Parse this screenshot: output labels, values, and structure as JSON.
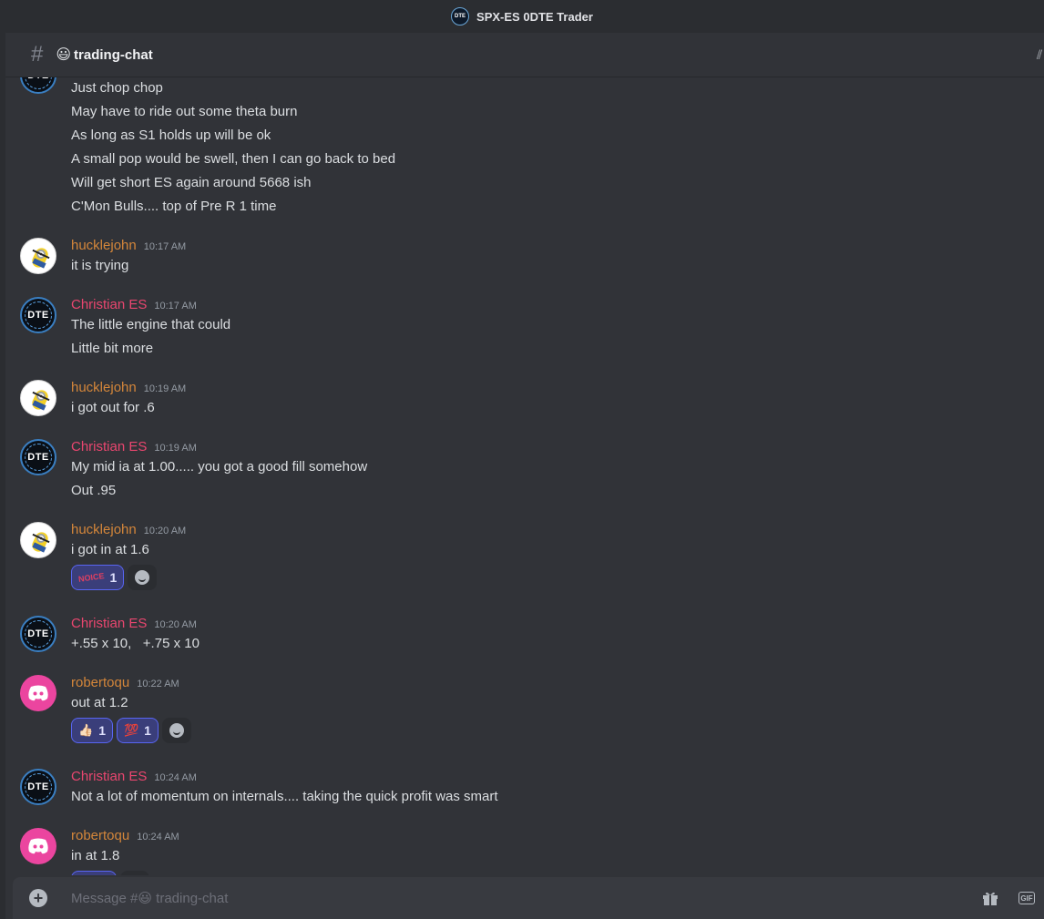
{
  "window": {
    "title": "SPX-ES 0DTE Trader",
    "server_icon_text": "DTE"
  },
  "channel": {
    "hash": "#",
    "emoji": "😃",
    "name": "trading-chat"
  },
  "first_group": {
    "lines": [
      "Just chop chop",
      "May have to ride out some theta burn",
      "As long as S1 holds up will be ok",
      "A small pop would be swell, then I can go back to bed",
      "Will get short ES again around 5668 ish",
      "C'Mon Bulls.... top of Pre R 1 time"
    ]
  },
  "messages": [
    {
      "user": "hucklejohn",
      "time": "10:17 AM",
      "lines": [
        "it is trying"
      ]
    },
    {
      "user": "Christian ES",
      "time": "10:17 AM",
      "lines": [
        "The little engine that could",
        "Little bit more"
      ]
    },
    {
      "user": "hucklejohn",
      "time": "10:19 AM",
      "lines": [
        "i got out for .6"
      ]
    },
    {
      "user": "Christian ES",
      "time": "10:19 AM",
      "lines": [
        "My mid ia at 1.00..... you got a good fill somehow",
        "Out .95"
      ]
    },
    {
      "user": "hucklejohn",
      "time": "10:20 AM",
      "lines": [
        "i got in at 1.6"
      ],
      "reactions": [
        {
          "emoji": "NOICE",
          "count": "1"
        }
      ]
    },
    {
      "user": "Christian ES",
      "time": "10:20 AM",
      "lines": [
        "+.55 x 10,   +.75 x 10"
      ]
    },
    {
      "user": "robertoqu",
      "time": "10:22 AM",
      "lines": [
        "out at 1.2"
      ],
      "reactions": [
        {
          "emoji": "👍🏻",
          "count": "1"
        },
        {
          "emoji": "💯",
          "count": "1"
        }
      ]
    },
    {
      "user": "Christian ES",
      "time": "10:24 AM",
      "lines": [
        "Not a lot of momentum on internals.... taking the quick profit was smart"
      ]
    },
    {
      "user": "robertoqu",
      "time": "10:24 AM",
      "lines": [
        "in at 1.8"
      ]
    }
  ],
  "composer": {
    "placeholder": "Message #😃 trading-chat",
    "gif_label": "GIF"
  },
  "colors": {
    "background": "#313338",
    "hucklejohn": "#d4863a",
    "christian": "#e9466f",
    "robertoqu": "#d4863a",
    "reaction_bg": "#3a3e7a"
  }
}
